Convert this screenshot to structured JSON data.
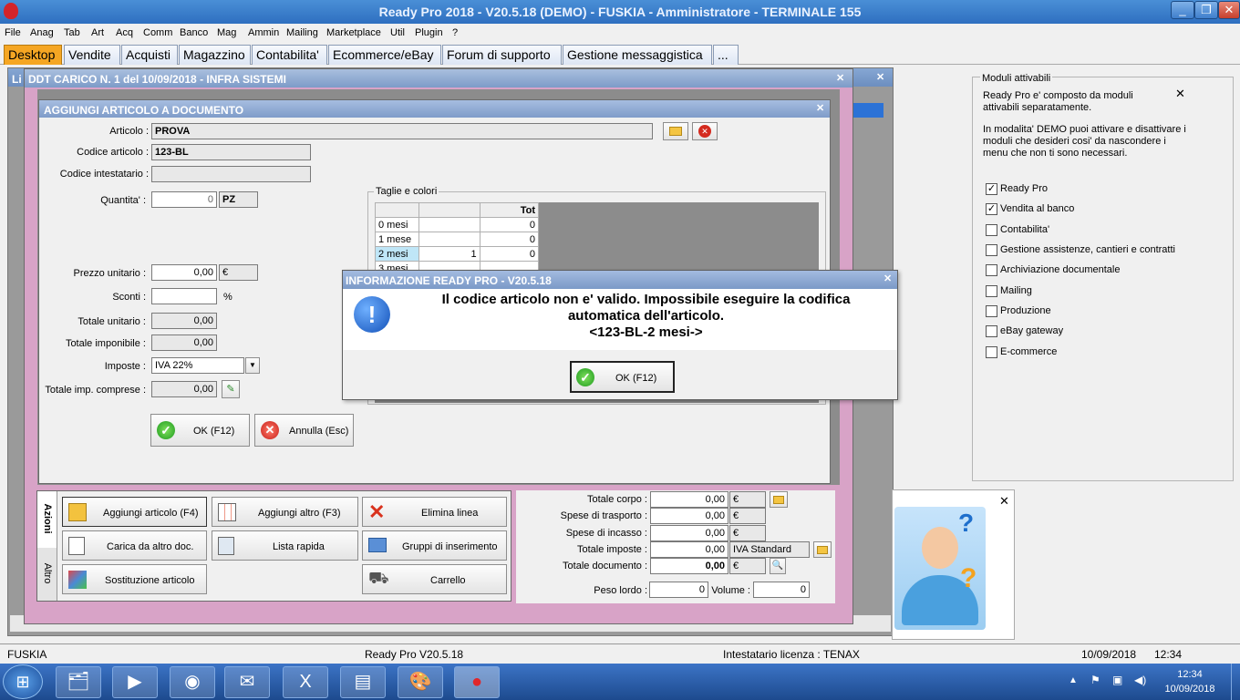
{
  "window": {
    "title": "Ready Pro 2018 - V20.5.18 (DEMO)  - FUSKIA - Amministratore - TERMINALE 155"
  },
  "menu": [
    "File",
    "Anag",
    "Tab",
    "Art",
    "Acq",
    "Comm",
    "Banco",
    "Mag",
    "Ammin",
    "Mailing",
    "Marketplace",
    "Util",
    "Plugin",
    "?"
  ],
  "tabs": [
    "Desktop",
    "Vendite",
    "Acquisti",
    "Magazzino",
    "Contabilita'",
    "Ecommerce/eBay",
    "Forum di supporto",
    "Gestione messaggistica",
    "..."
  ],
  "bg_window_prefix": "Li",
  "ddt": {
    "title": "DDT CARICO N. 1 del 10/09/2018 - INFRA SISTEMI"
  },
  "add": {
    "title": "AGGIUNGI ARTICOLO A DOCUMENTO",
    "articolo_label": "Articolo :",
    "articolo": "PROVA",
    "codice_label": "Codice articolo :",
    "codice": "123-BL",
    "codice_int_label": "Codice intestatario :",
    "codice_int": "",
    "quantita_label": "Quantita' :",
    "quantita": "0",
    "um": "PZ",
    "prezzo_label": "Prezzo unitario :",
    "prezzo": "0,00",
    "valuta": "€",
    "sconti_label": "Sconti :",
    "sconti": "",
    "pct": "%",
    "tot_unit_label": "Totale unitario :",
    "tot_unit": "0,00",
    "tot_imp_label": "Totale imponibile :",
    "tot_imp": "0,00",
    "imposte_label": "Imposte :",
    "imposte": "IVA 22%",
    "tot_comp_label": "Totale imp. comprese :",
    "tot_comp": "0,00",
    "ok": "OK (F12)",
    "annulla": "Annulla (Esc)",
    "taglie_label": "Taglie e colori",
    "grid_header": "Tot",
    "grid_rows": [
      {
        "name": "0 mesi",
        "val": "",
        "tot": "0"
      },
      {
        "name": "1 mese",
        "val": "",
        "tot": "0"
      },
      {
        "name": "2 mesi",
        "val": "1",
        "tot": "0"
      },
      {
        "name": "3 mesi",
        "val": "",
        "tot": ""
      }
    ]
  },
  "dialog": {
    "title": "INFORMAZIONE READY PRO - V20.5.18",
    "line1": "Il codice articolo non e' valido. Impossibile eseguire la codifica",
    "line2": "automatica dell'articolo.",
    "line3": "<123-BL-2 mesi->",
    "ok": "OK (F12)"
  },
  "azioni": {
    "tab_azioni": "Azioni",
    "tab_altro": "Altro",
    "buttons": [
      "Aggiungi articolo (F4)",
      "Aggiungi altro (F3)",
      "Elimina linea",
      "Carica da altro doc.",
      "Lista rapida",
      "Gruppi di inserimento",
      "Sostituzione articolo",
      "Carrello"
    ]
  },
  "totali": {
    "corpo_label": "Totale corpo :",
    "corpo": "0,00",
    "trasporto_label": "Spese di trasporto :",
    "trasporto": "0,00",
    "incasso_label": "Spese di incasso :",
    "incasso": "0,00",
    "imposte_label": "Totale imposte :",
    "imposte": "0,00",
    "iva": "IVA Standard",
    "documento_label": "Totale documento :",
    "documento": "0,00",
    "peso_label": "Peso lordo :",
    "peso": "0",
    "volume_label": "Volume :",
    "volume": "0",
    "valuta": "€"
  },
  "moduli": {
    "title": "Moduli attivabili",
    "desc1": "Ready Pro e' composto da moduli attivabili separatamente.",
    "desc2": "In modalita' DEMO puoi attivare e disattivare i moduli che desideri cosi' da nascondere i menu che non ti sono necessari.",
    "items": [
      {
        "label": "Ready Pro",
        "checked": "✓"
      },
      {
        "label": "Vendita al banco",
        "checked": "✓"
      },
      {
        "label": "Contabilita'",
        "checked": ""
      },
      {
        "label": "Gestione assistenze, cantieri e contratti",
        "checked": ""
      },
      {
        "label": "Archiviazione documentale",
        "checked": ""
      },
      {
        "label": "Mailing",
        "checked": ""
      },
      {
        "label": "Produzione",
        "checked": ""
      },
      {
        "label": "eBay gateway",
        "checked": ""
      },
      {
        "label": "E-commerce",
        "checked": ""
      }
    ]
  },
  "status": {
    "company": "FUSKIA",
    "version": "Ready Pro V20.5.18",
    "license": "Intestatario licenza : TENAX",
    "date": "10/09/2018",
    "time": "12:34"
  },
  "clock": {
    "time": "12:34",
    "date": "10/09/2018"
  },
  "colors": {
    "accent": "#f5a623",
    "pink_frame": "#d8a3c7",
    "title_blue": "#2e6fc0"
  }
}
